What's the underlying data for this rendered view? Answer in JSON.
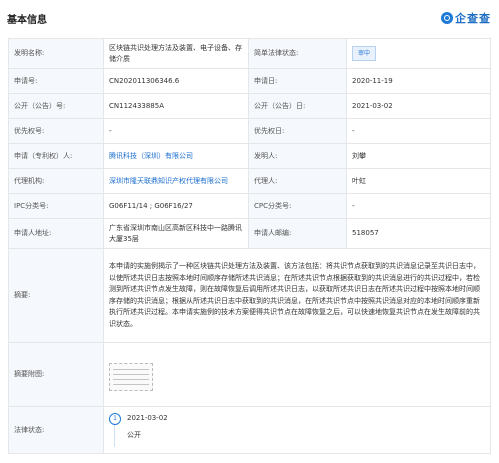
{
  "header": {
    "title": "基本信息",
    "logo_text": "企查查"
  },
  "rows": {
    "invention_name": {
      "label": "发明名称:",
      "value": "区块链共识处理方法及装置、电子设备、存储介质"
    },
    "legal_status": {
      "label": "简单法律状态:",
      "value": "审中"
    },
    "app_no": {
      "label": "申请号:",
      "value": "CN202011306346.6"
    },
    "app_date": {
      "label": "申请日:",
      "value": "2020-11-19"
    },
    "pub_no": {
      "label": "公开（公告）号:",
      "value": "CN112433885A"
    },
    "pub_date": {
      "label": "公开（公告）日:",
      "value": "2021-03-02"
    },
    "priority_no": {
      "label": "优先权号:",
      "value": "-"
    },
    "priority_date": {
      "label": "优先权日:",
      "value": "-"
    },
    "applicant": {
      "label": "申请（专利权）人:",
      "value": "腾讯科技（深圳）有限公司"
    },
    "inventor": {
      "label": "发明人:",
      "value": "刘攀"
    },
    "agency": {
      "label": "代理机构:",
      "value": "深圳市隆天联鼎知识产权代理有限公司"
    },
    "agent": {
      "label": "代理人:",
      "value": "叶虹"
    },
    "ipc": {
      "label": "IPC分类号:",
      "value": "G06F11/14 ; G06F16/27"
    },
    "cpc": {
      "label": "CPC分类号:",
      "value": "-"
    },
    "address": {
      "label": "申请人地址:",
      "value": "广东省深圳市南山区高新区科技中一路腾讯大厦35层"
    },
    "zip": {
      "label": "申请人邮编:",
      "value": "518057"
    },
    "abstract": {
      "label": "摘要:",
      "value": "本申请的实施例揭示了一种区块链共识处理方法及装置、该方法包括：将共识节点获取到的共识消息记录至共识日志中，以使所述共识日志按照本地时间顺序存储所述共识消息；在所述共识节点根据获取到的共识消息进行的共识过程中，若检测到所述共识节点发生故障，则在故障恢复后调用所述共识日志，以获取所述共识日志在所述共识过程中按照本地时间顺序存储的共识消息；根据从所述共识日志中获取到的共识消息，在所述共识节点中按照共识消息对应的本地时间顺序重新执行所述共识过程。本申请实施例的技术方案便得共识节点在故障恢复之后，可以快速地恢复共识节点在发生故障前的共识状态。"
    },
    "abstract_figure": {
      "label": "摘要附图:"
    },
    "legal_state": {
      "label": "法律状态:",
      "step_no": "1",
      "date": "2021-03-02",
      "status": "公开"
    }
  }
}
